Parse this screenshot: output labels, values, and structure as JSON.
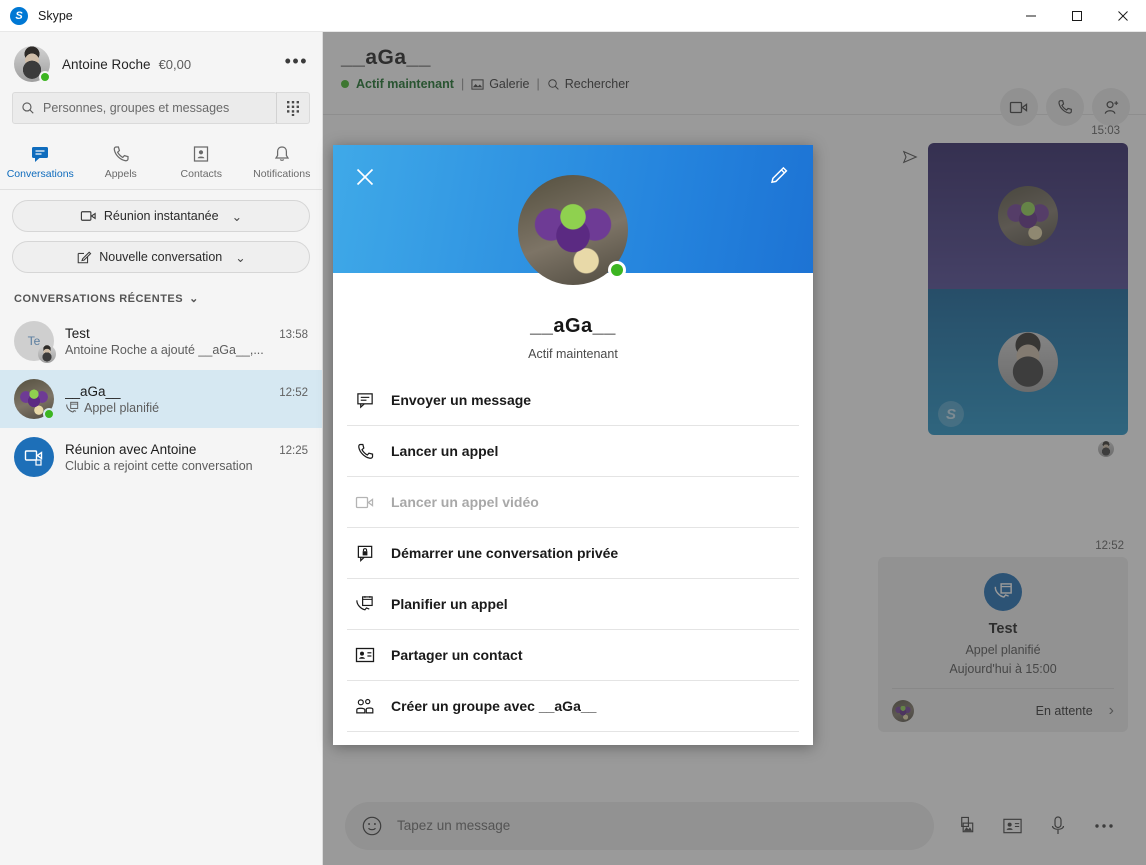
{
  "window": {
    "title": "Skype",
    "logo_icon": "skype-logo-icon",
    "minimize_label": "Réduire",
    "maximize_label": "Agrandir",
    "close_label": "Fermer"
  },
  "sidebar": {
    "profile": {
      "name": "Antoine Roche",
      "balance": "€0,00",
      "more_label": "•••",
      "presence": "online"
    },
    "search": {
      "placeholder": "Personnes, groupes et messages",
      "value": "",
      "icon": "search-icon",
      "dialpad_icon": "dialpad-icon"
    },
    "tabs": [
      {
        "label": "Conversations",
        "icon": "chat-icon",
        "active": true
      },
      {
        "label": "Appels",
        "icon": "phone-icon",
        "active": false
      },
      {
        "label": "Contacts",
        "icon": "contact-card-icon",
        "active": false
      },
      {
        "label": "Notifications",
        "icon": "bell-icon",
        "active": false
      }
    ],
    "actions": [
      {
        "label": "Réunion instantanée",
        "icon": "video-icon",
        "chevron": "⌄"
      },
      {
        "label": "Nouvelle conversation",
        "icon": "compose-icon",
        "chevron": "⌄"
      }
    ],
    "section_title": "CONVERSATIONS RÉCENTES",
    "section_chevron": "⌄",
    "conversations": [
      {
        "name": "Test",
        "preview": "Antoine Roche a ajouté __aGa__,...",
        "time": "13:58",
        "avatar_text": "Te",
        "selected": false
      },
      {
        "name": "__aGa__",
        "preview": "Appel planifié",
        "time": "12:52",
        "preview_icon": "scheduled-call-icon",
        "selected": true
      },
      {
        "name": "Réunion avec Antoine",
        "preview": "Clubic a rejoint cette conversation",
        "time": "12:25",
        "selected": false
      }
    ]
  },
  "chat": {
    "title": "__aGa__",
    "status": "Actif maintenant",
    "gallery_label": "Galerie",
    "search_label": "Rechercher",
    "separator": "|",
    "actions": [
      {
        "label": "Appel vidéo",
        "icon": "video-call-icon"
      },
      {
        "label": "Appel audio",
        "icon": "phone-call-icon"
      },
      {
        "label": "Ajouter des personnes",
        "icon": "add-person-icon"
      }
    ],
    "messages": [
      {
        "type": "call-thumbnail",
        "time": "15:03",
        "sent_icon": "sent-arrow-icon"
      }
    ],
    "scheduled_card": {
      "time": "12:52",
      "icon": "scheduled-call-icon",
      "title": "Test",
      "subtitle": "Appel planifié",
      "date": "Aujourd'hui à 15:00",
      "status": "En attente",
      "arrow": "›"
    },
    "composer": {
      "placeholder": "Tapez un message",
      "value": "",
      "emoji_icon": "emoji-icon",
      "buttons": [
        {
          "label": "Envoyer une image",
          "icon": "image-icon"
        },
        {
          "label": "Partager un contact",
          "icon": "contact-card-icon"
        },
        {
          "label": "Message vocal",
          "icon": "microphone-icon"
        },
        {
          "label": "Plus d'options",
          "icon": "more-icon"
        }
      ]
    }
  },
  "modal": {
    "close_icon": "close-icon",
    "edit_icon": "pencil-icon",
    "name": "__aGa__",
    "status": "Actif maintenant",
    "presence": "online",
    "items": [
      {
        "label": "Envoyer un message",
        "icon": "message-icon",
        "disabled": false
      },
      {
        "label": "Lancer un appel",
        "icon": "phone-icon",
        "disabled": false
      },
      {
        "label": "Lancer un appel vidéo",
        "icon": "video-icon",
        "disabled": true
      },
      {
        "label": "Démarrer une conversation privée",
        "icon": "lock-chat-icon",
        "disabled": false
      },
      {
        "label": "Planifier un appel",
        "icon": "schedule-call-icon",
        "disabled": false
      },
      {
        "label": "Partager un contact",
        "icon": "contact-card-icon",
        "disabled": false
      },
      {
        "label": "Créer un groupe avec __aGa__",
        "icon": "group-icon",
        "disabled": false
      }
    ]
  },
  "colors": {
    "accent": "#0f6cbd",
    "header_gradient_start": "#3fa9e8",
    "header_gradient_end": "#1d73d4",
    "presence_online": "#3cb521",
    "selected_row": "#d6e8f2",
    "overlay": "#404040"
  }
}
